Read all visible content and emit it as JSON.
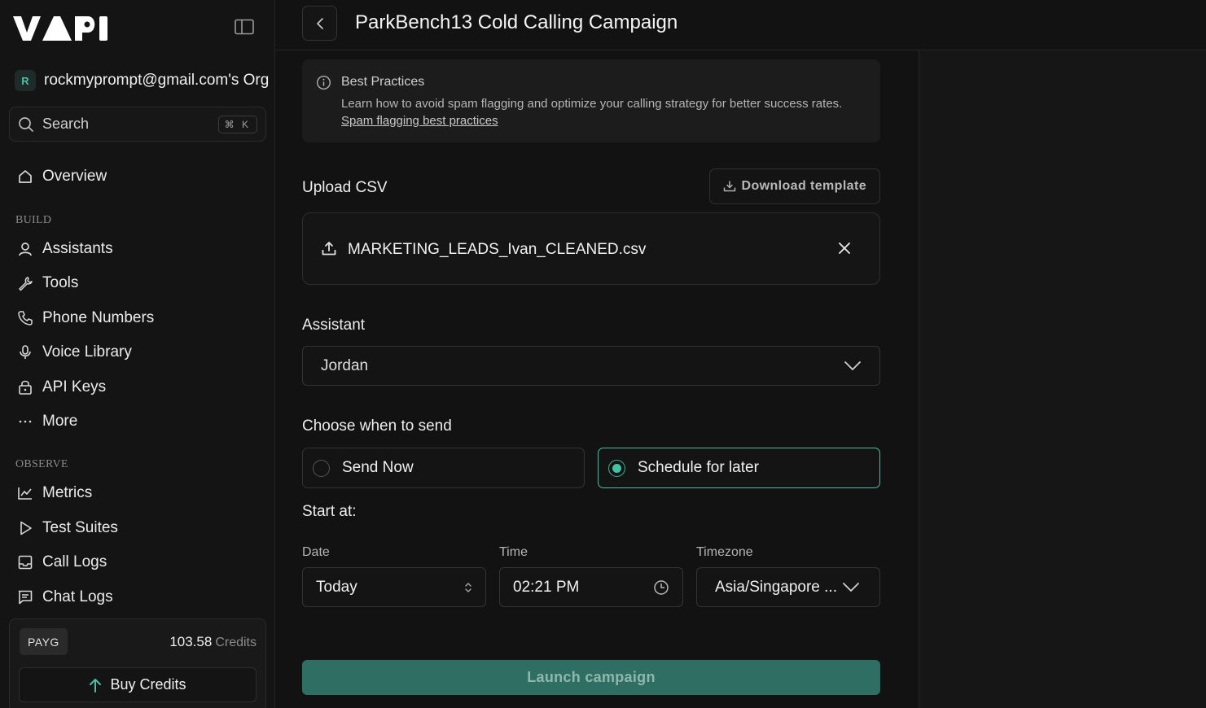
{
  "sidebar": {
    "logo_text": "VAPI",
    "org": {
      "initial": "R",
      "name": "rockmyprompt@gmail.com's Org"
    },
    "search": {
      "placeholder": "Search",
      "shortcut": "⌘ K"
    },
    "overview": "Overview",
    "build_label": "BUILD",
    "build_items": [
      "Assistants",
      "Tools",
      "Phone Numbers",
      "Voice Library",
      "API Keys",
      "More"
    ],
    "observe_label": "OBSERVE",
    "observe_items": [
      "Metrics",
      "Test Suites",
      "Call Logs",
      "Chat Logs"
    ],
    "credits": {
      "plan": "PAYG",
      "amount": "103.58",
      "unit": "Credits",
      "buy_label": "Buy Credits"
    }
  },
  "header": {
    "title": "ParkBench13 Cold Calling Campaign"
  },
  "best_practices": {
    "title": "Best Practices",
    "description": "Learn how to avoid spam flagging and optimize your calling strategy for better success rates.",
    "link": "Spam flagging best practices"
  },
  "upload": {
    "label": "Upload CSV",
    "download_label": "Download template",
    "file_name": "MARKETING_LEADS_Ivan_CLEANED.csv"
  },
  "assistant": {
    "label": "Assistant",
    "selected": "Jordan"
  },
  "send": {
    "label": "Choose when to send",
    "options": [
      "Send Now",
      "Schedule for later"
    ],
    "selected": "Schedule for later"
  },
  "schedule": {
    "start_label": "Start at:",
    "date_label": "Date",
    "date_value": "Today",
    "time_label": "Time",
    "time_value": "02:21 PM",
    "timezone_label": "Timezone",
    "timezone_value": "Asia/Singapore ..."
  },
  "launch_label": "Launch campaign",
  "colors": {
    "accent": "#45c1a6",
    "launch_bg": "#2f6f63",
    "background": "#121212"
  }
}
